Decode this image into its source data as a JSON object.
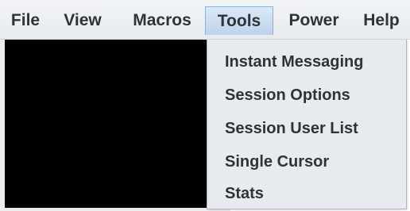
{
  "menubar": {
    "items": [
      {
        "label": "File"
      },
      {
        "label": "View"
      },
      {
        "label": "Macros"
      },
      {
        "label": "Tools"
      },
      {
        "label": "Power"
      },
      {
        "label": "Help"
      }
    ],
    "active": "Tools"
  },
  "tools_menu": {
    "items": [
      {
        "label": "Instant Messaging"
      },
      {
        "label": "Session Options"
      },
      {
        "label": "Session User List"
      },
      {
        "label": "Single Cursor"
      },
      {
        "label": "Stats"
      }
    ]
  },
  "colors": {
    "menubar_bg": "#eceff3",
    "active_menu_bg": "#c9dcf1",
    "dropdown_bg": "#e7eaef",
    "content_bg": "#000000",
    "text": "#2f3338"
  }
}
